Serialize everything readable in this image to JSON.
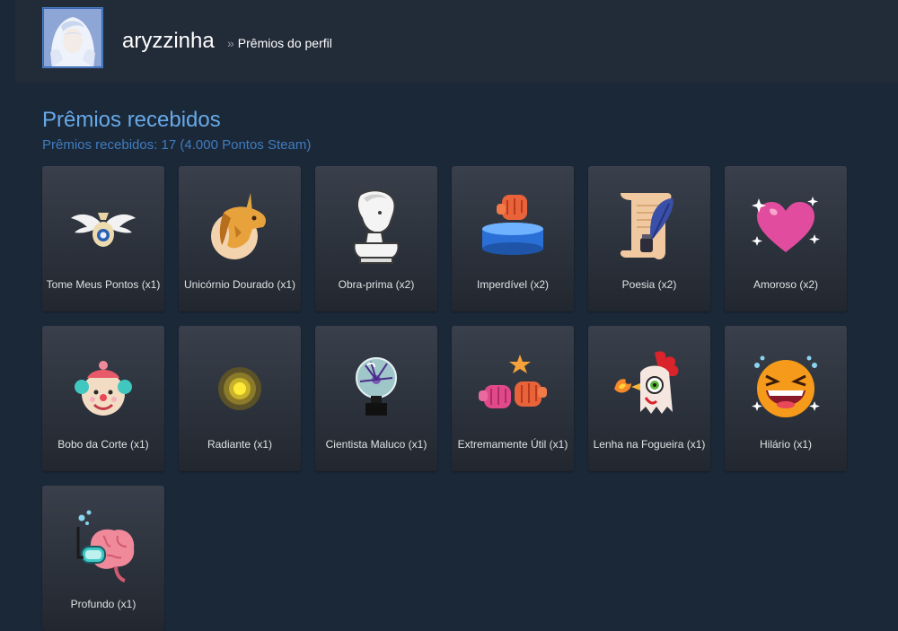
{
  "header": {
    "persona_name": "aryzzinha",
    "breadcrumb_separator": "»",
    "breadcrumb_page": "Prêmios do perfil"
  },
  "section": {
    "title": "Prêmios recebidos",
    "summary": "Prêmios recebidos: 17 (4.000 Pontos Steam)"
  },
  "awards": [
    {
      "label": "Tome Meus Pontos (x1)",
      "icon": "winged-coin-bag-icon"
    },
    {
      "label": "Unicórnio Dourado (x1)",
      "icon": "golden-unicorn-icon"
    },
    {
      "label": "Obra-prima (x2)",
      "icon": "marble-bust-icon"
    },
    {
      "label": "Imperdível (x2)",
      "icon": "button-fist-icon"
    },
    {
      "label": "Poesia (x2)",
      "icon": "quill-scroll-icon"
    },
    {
      "label": "Amoroso (x2)",
      "icon": "sparkling-heart-icon"
    },
    {
      "label": "Bobo da Corte (x1)",
      "icon": "clown-face-icon"
    },
    {
      "label": "Radiante (x1)",
      "icon": "radiant-orb-icon"
    },
    {
      "label": "Cientista Maluco (x1)",
      "icon": "plasma-globe-icon"
    },
    {
      "label": "Extremamente Útil (x1)",
      "icon": "fist-bump-star-icon"
    },
    {
      "label": "Lenha na Fogueira (x1)",
      "icon": "fire-chicken-icon"
    },
    {
      "label": "Hilário (x1)",
      "icon": "laughing-face-icon"
    },
    {
      "label": "Profundo (x1)",
      "icon": "diving-brain-icon"
    }
  ]
}
